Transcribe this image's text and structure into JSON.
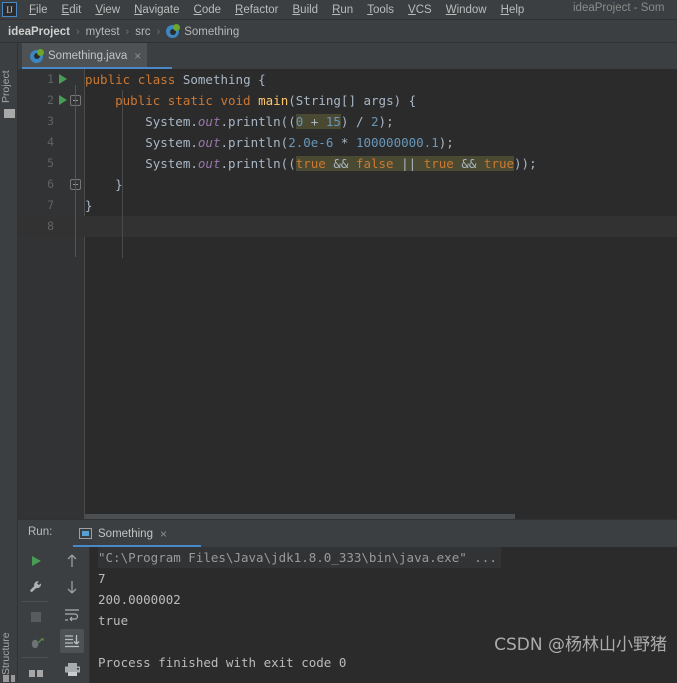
{
  "window": {
    "title": "ideaProject - Som",
    "app_icon": "intellij-idea-logo-icon"
  },
  "menubar": {
    "items": [
      {
        "label": "File",
        "mnemonic": "F"
      },
      {
        "label": "Edit",
        "mnemonic": "E"
      },
      {
        "label": "View",
        "mnemonic": "V"
      },
      {
        "label": "Navigate",
        "mnemonic": "N"
      },
      {
        "label": "Code",
        "mnemonic": "C"
      },
      {
        "label": "Refactor",
        "mnemonic": "R"
      },
      {
        "label": "Build",
        "mnemonic": "B"
      },
      {
        "label": "Run",
        "mnemonic": "R"
      },
      {
        "label": "Tools",
        "mnemonic": "T"
      },
      {
        "label": "VCS",
        "mnemonic": "V"
      },
      {
        "label": "Window",
        "mnemonic": "W"
      },
      {
        "label": "Help",
        "mnemonic": "H"
      }
    ]
  },
  "breadcrumb": {
    "items": [
      "ideaProject",
      "mytest",
      "src",
      "Something"
    ],
    "separator": "›",
    "class_icon": "java-class-icon"
  },
  "left_stripe": {
    "project_label": "Project",
    "structure_label": "Structure"
  },
  "editor_tabs": [
    {
      "label": "Something.java",
      "close": "×",
      "icon": "java-class-icon",
      "active": true
    }
  ],
  "editor": {
    "lines": [
      {
        "num": "1",
        "run_marker": true,
        "fold": false
      },
      {
        "num": "2",
        "run_marker": true,
        "fold": true
      },
      {
        "num": "3",
        "run_marker": false,
        "fold": false
      },
      {
        "num": "4",
        "run_marker": false,
        "fold": false
      },
      {
        "num": "5",
        "run_marker": false,
        "fold": false
      },
      {
        "num": "6",
        "run_marker": false,
        "fold": true
      },
      {
        "num": "7",
        "run_marker": false,
        "fold": false
      },
      {
        "num": "8",
        "run_marker": false,
        "fold": false
      }
    ],
    "code_text": [
      "public class Something {",
      "    public static void main(String[] args) {",
      "        System.out.println((0 + 15) / 2);",
      "        System.out.println(2.0e-6 * 100000000.1);",
      "        System.out.println((true && false || true && true));",
      "    }",
      "}",
      ""
    ],
    "caret_line": 8,
    "colors": {
      "background": "#2b2b2b",
      "gutter": "#313335",
      "keyword": "#cc7832",
      "number": "#6897bb",
      "field": "#9876aa",
      "default_text": "#a9b7c6",
      "highlight": "#4a4a33",
      "caret_row": "#323232"
    }
  },
  "run_panel": {
    "run_label": "Run:",
    "tab": {
      "label": "Something",
      "close": "×",
      "icon": "console-icon"
    },
    "toolbar_left": [
      {
        "name": "rerun-button",
        "icon": "play-icon"
      },
      {
        "name": "settings-button",
        "icon": "wrench-icon"
      },
      {
        "name": "stop-button",
        "icon": "stop-square-icon"
      },
      {
        "name": "debug-button",
        "icon": "bug-icon"
      },
      {
        "name": "layout-button",
        "icon": "layout-icon"
      }
    ],
    "toolbar_right": [
      {
        "name": "up-button",
        "icon": "arrow-up-icon",
        "selected": false
      },
      {
        "name": "down-button",
        "icon": "arrow-down-icon",
        "selected": false
      },
      {
        "name": "soft-wrap-button",
        "icon": "soft-wrap-icon",
        "selected": false
      },
      {
        "name": "scroll-to-end-button",
        "icon": "scroll-to-end-icon",
        "selected": true
      },
      {
        "name": "print-button",
        "icon": "printer-icon",
        "selected": false
      }
    ],
    "console_lines": [
      {
        "text": "\"C:\\Program Files\\Java\\jdk1.8.0_333\\bin\\java.exe\" ...",
        "type": "system"
      },
      {
        "text": "7",
        "type": "stdout"
      },
      {
        "text": "200.0000002",
        "type": "stdout"
      },
      {
        "text": "true",
        "type": "stdout"
      },
      {
        "text": "",
        "type": "stdout"
      },
      {
        "text": "Process finished with exit code 0",
        "type": "stdout"
      }
    ]
  },
  "watermark": {
    "text": "CSDN @杨林山小野猪"
  }
}
